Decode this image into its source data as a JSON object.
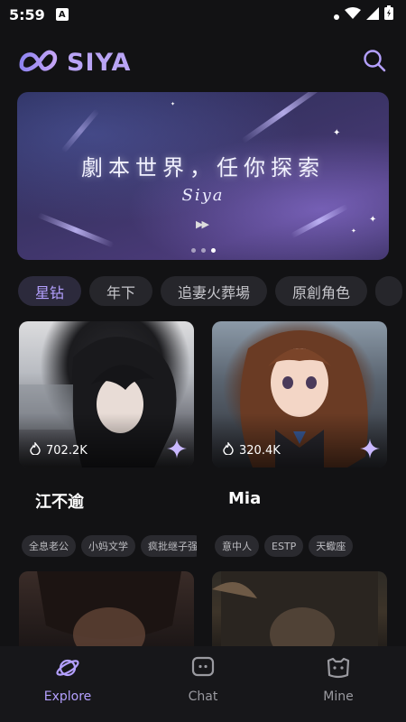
{
  "status_bar": {
    "time": "5:59",
    "notif_letter": "A"
  },
  "header": {
    "logo_text": "SIYA"
  },
  "banner": {
    "title": "劇本世界，任你探索",
    "subtitle": "Siya",
    "play_glyph": "▶▶",
    "dots": 3,
    "active_dot": 2
  },
  "categories": [
    {
      "label": "星钻",
      "active": true
    },
    {
      "label": "年下",
      "active": false
    },
    {
      "label": "追妻火葬場",
      "active": false
    },
    {
      "label": "原創角色",
      "active": false
    },
    {
      "label": "",
      "active": false
    }
  ],
  "cards": [
    {
      "name": "江不逾",
      "likes": "702.2K",
      "tags": [
        "全息老公",
        "小妈文学",
        "疯批继子强"
      ]
    },
    {
      "name": "Mia",
      "likes": "320.4K",
      "tags": [
        "意中人",
        "ESTP",
        "天蠍座"
      ]
    }
  ],
  "bottom_nav": [
    {
      "label": "Explore",
      "icon": "planet-icon",
      "active": true
    },
    {
      "label": "Chat",
      "icon": "chat-bubble-icon",
      "active": false
    },
    {
      "label": "Mine",
      "icon": "profile-face-icon",
      "active": false
    }
  ],
  "colors": {
    "accent": "#b4a0ff",
    "background": "#121214",
    "chip_bg": "#26262b"
  }
}
